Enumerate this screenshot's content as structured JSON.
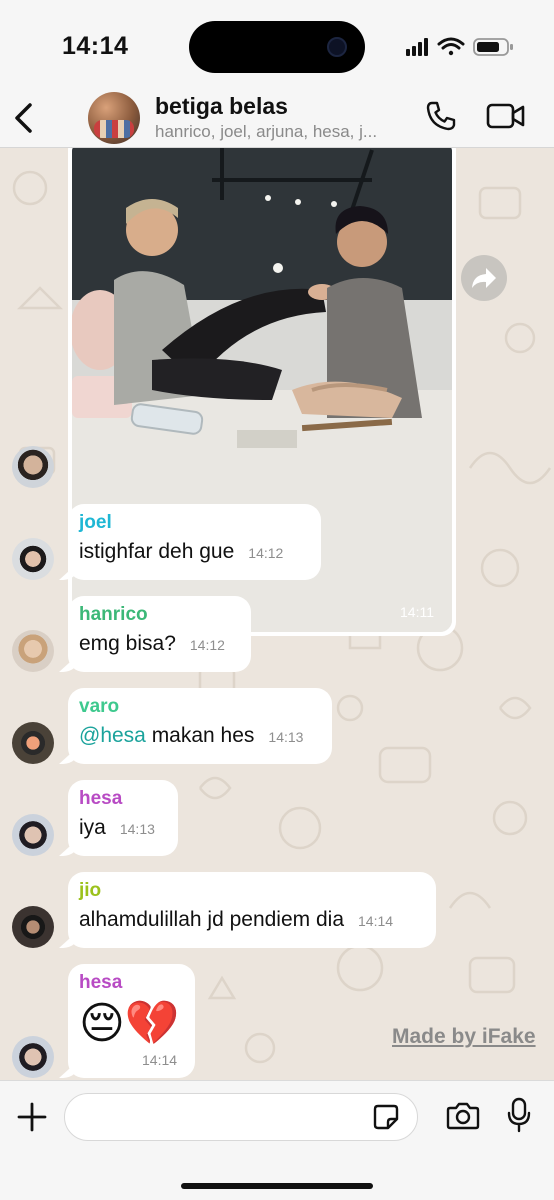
{
  "status_bar": {
    "time": "14:14"
  },
  "header": {
    "title": "betiga belas",
    "members": "hanrico, joel, arjuna, hesa, j..."
  },
  "image_message": {
    "time": "14:11"
  },
  "messages": [
    {
      "sender": "joel",
      "sender_color": "#1fb7d4",
      "text": "istighfar deh gue",
      "time": "14:12"
    },
    {
      "sender": "hanrico",
      "sender_color": "#3cb878",
      "text": "emg bisa?",
      "time": "14:12"
    },
    {
      "sender": "varo",
      "sender_color": "#3ec98e",
      "mention": "@hesa",
      "text": " makan hes",
      "time": "14:13"
    },
    {
      "sender": "hesa",
      "sender_color": "#b84bc4",
      "text": "iya",
      "time": "14:13"
    },
    {
      "sender": "jio",
      "sender_color": "#9cc21c",
      "text": "alhamdulillah jd pendiem dia",
      "time": "14:14"
    },
    {
      "sender": "hesa",
      "sender_color": "#b84bc4",
      "emoji": "😔💔",
      "time": "14:14"
    }
  ],
  "watermark": "Made by iFake",
  "input": {
    "placeholder": ""
  },
  "colors": {
    "chat_bg": "#ece5dd",
    "bubble": "#ffffff",
    "mention": "#1ba39c"
  },
  "icons": [
    "back-icon",
    "phone-icon",
    "video-icon",
    "forward-icon",
    "plus-icon",
    "sticker-icon",
    "camera-icon",
    "mic-icon"
  ]
}
